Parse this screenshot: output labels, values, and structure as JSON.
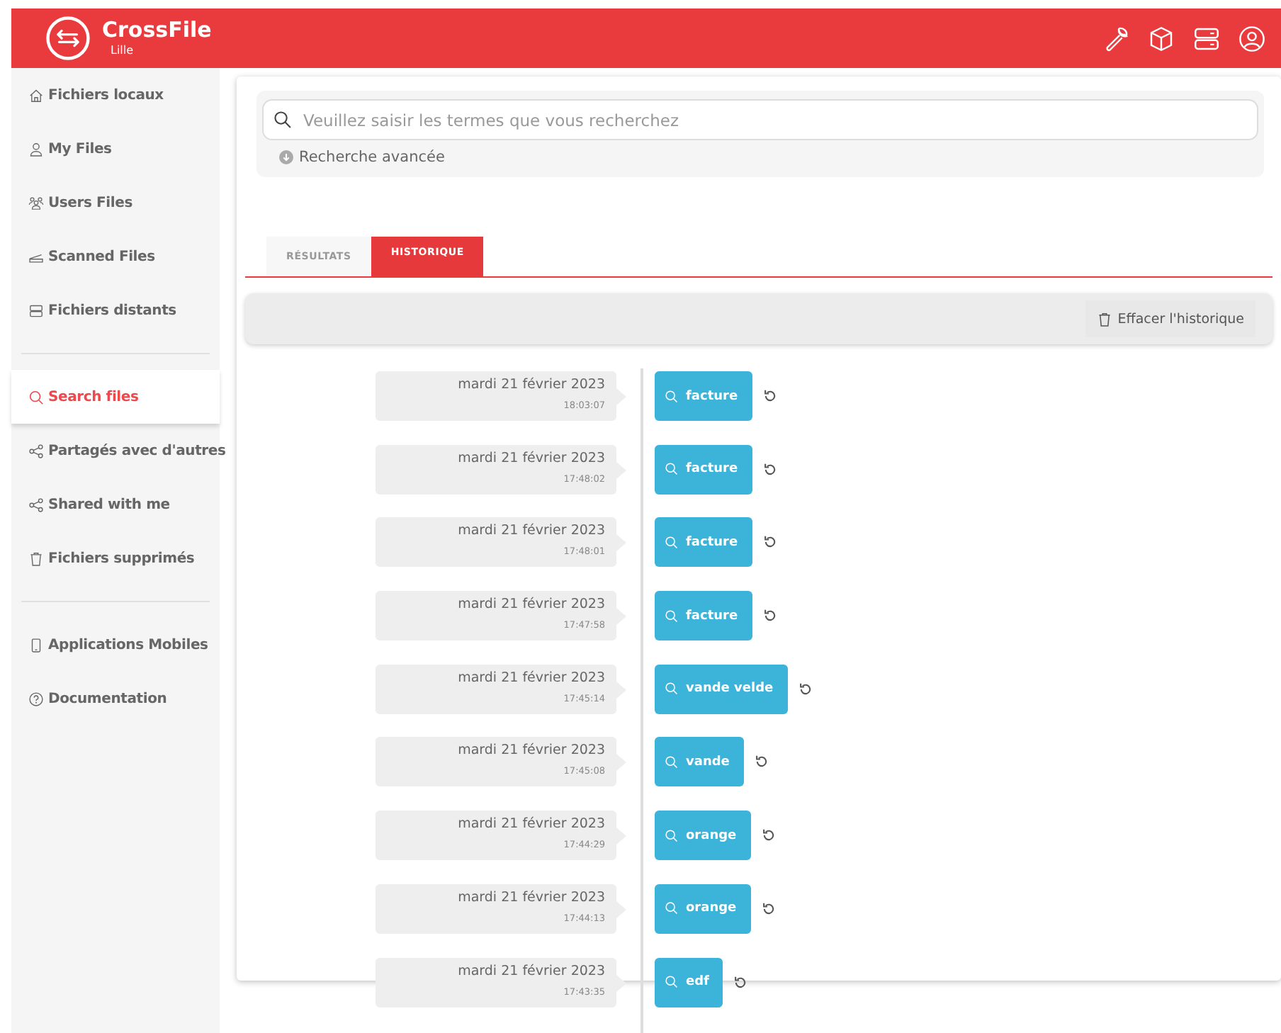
{
  "header": {
    "app_name": "CrossFile",
    "site": "Lille"
  },
  "sidebar": {
    "groups": [
      [
        {
          "label": "Fichiers locaux",
          "selected": false
        },
        {
          "label": "My Files",
          "selected": false
        },
        {
          "label": "Users Files",
          "selected": false
        },
        {
          "label": "Scanned Files",
          "selected": false
        },
        {
          "label": "Fichiers distants",
          "selected": false
        }
      ],
      [
        {
          "label": "Search files",
          "selected": true
        },
        {
          "label": "Partagés avec d'autres",
          "selected": false
        },
        {
          "label": "Shared with me",
          "selected": false
        },
        {
          "label": "Fichiers supprimés",
          "selected": false
        }
      ],
      [
        {
          "label": "Applications Mobiles",
          "selected": false
        },
        {
          "label": "Documentation",
          "selected": false
        }
      ]
    ]
  },
  "search": {
    "placeholder": "Veuillez saisir les termes que vous recherchez",
    "advanced": "Recherche avancée"
  },
  "tabs": [
    {
      "label": "RÉSULTATS",
      "selected": false
    },
    {
      "label": "HISTORIQUE",
      "selected": true
    }
  ],
  "clear_history": "Effacer l'historique",
  "history": [
    {
      "date": "mardi 21 février 2023",
      "time": "18:03:07",
      "term": "facture"
    },
    {
      "date": "mardi 21 février 2023",
      "time": "17:48:02",
      "term": "facture"
    },
    {
      "date": "mardi 21 février 2023",
      "time": "17:48:01",
      "term": "facture"
    },
    {
      "date": "mardi 21 février 2023",
      "time": "17:47:58",
      "term": "facture"
    },
    {
      "date": "mardi 21 février 2023",
      "time": "17:45:14",
      "term": "vande velde"
    },
    {
      "date": "mardi 21 février 2023",
      "time": "17:45:08",
      "term": "vande"
    },
    {
      "date": "mardi 21 février 2023",
      "time": "17:44:29",
      "term": "orange"
    },
    {
      "date": "mardi 21 février 2023",
      "time": "17:44:13",
      "term": "orange"
    },
    {
      "date": "mardi 21 février 2023",
      "time": "17:43:35",
      "term": "edf"
    }
  ]
}
